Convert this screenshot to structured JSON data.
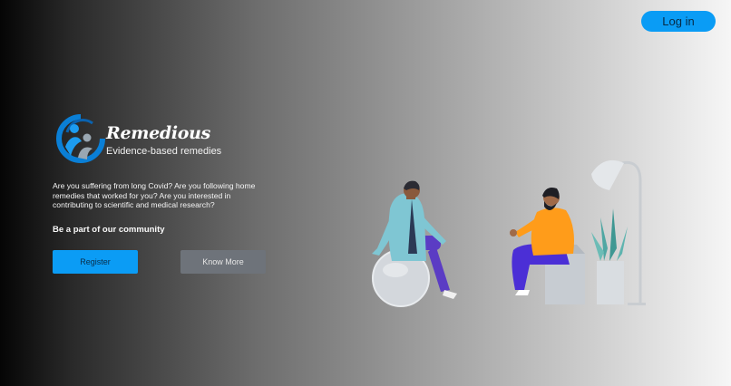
{
  "header": {
    "login_label": "Log in"
  },
  "brand": {
    "name": "Remedious",
    "tagline": "Evidence-based remedies"
  },
  "hero": {
    "intro": "Are you suffering from long Covid? Are you following home remedies that worked for you? Are you interested in contributing to scientific and medical research?",
    "community": "Be a part of our community",
    "register_label": "Register",
    "know_more_label": "Know More"
  },
  "colors": {
    "accent": "#0a9cf5",
    "secondary_button": "#6e737a"
  },
  "icons": {
    "logo": "people-circle-logo-icon",
    "illustration": "doctor-patient-consultation-illustration"
  }
}
